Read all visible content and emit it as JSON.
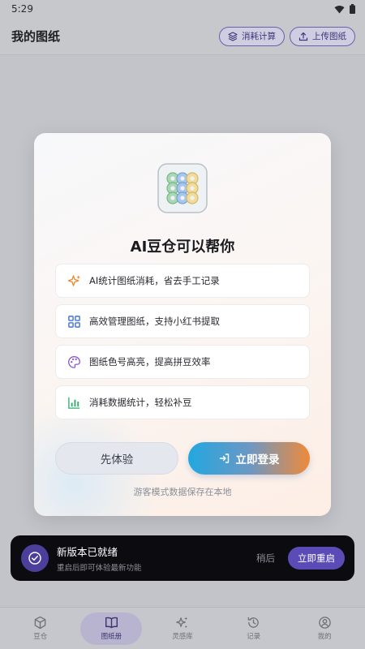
{
  "status_bar": {
    "time": "5:29"
  },
  "app_bar": {
    "title": "我的图纸",
    "consumption_button": "消耗计算",
    "upload_button": "上传图纸"
  },
  "modal": {
    "title": "AI豆仓可以帮你",
    "features": [
      {
        "icon": "sparkle-icon",
        "label": "AI统计图纸消耗，省去手工记录"
      },
      {
        "icon": "grid-icon",
        "label": "高效管理图纸，支持小红书提取"
      },
      {
        "icon": "palette-icon",
        "label": "图纸色号高亮，提高拼豆效率"
      },
      {
        "icon": "bar-chart-icon",
        "label": "消耗数据统计，轻松补豆"
      }
    ],
    "guest_button": "先体验",
    "login_button": "立即登录",
    "guest_note": "游客模式数据保存在本地"
  },
  "toast": {
    "title": "新版本已就绪",
    "subtitle": "重启后即可体验最新功能",
    "later": "稍后",
    "restart": "立即重启"
  },
  "bottom_nav": {
    "items": [
      {
        "label": "豆仓",
        "icon": "cube-icon",
        "active": false
      },
      {
        "label": "图纸册",
        "icon": "book-icon",
        "active": true
      },
      {
        "label": "灵感库",
        "icon": "sparkles-icon",
        "active": false
      },
      {
        "label": "记录",
        "icon": "history-icon",
        "active": false
      },
      {
        "label": "我的",
        "icon": "profile-icon",
        "active": false
      }
    ]
  },
  "colors": {
    "accent": "#5a4bb7",
    "login_gradient_start": "#22a7e0",
    "login_gradient_end": "#ef8a3a",
    "sparkle": "#f08a2c",
    "grid": "#3f74d6",
    "palette": "#8a56d2",
    "bar_chart": "#2fae6b"
  }
}
